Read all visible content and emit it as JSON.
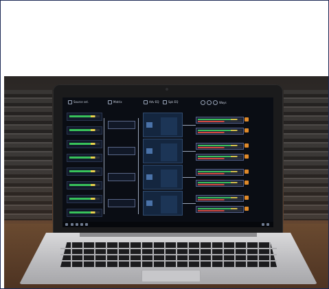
{
  "ui": {
    "sections": {
      "source": "Source sel.",
      "matrix": "Matrix",
      "adv": "Adv EQ",
      "spk": "Spk EQ",
      "ways": "Ways"
    }
  },
  "colors": {
    "meter_green": "#38c35a",
    "meter_yellow": "#e7d24c",
    "meter_red": "#d2473f",
    "mute_orange": "#e08a2a",
    "panel_blue": "#14263f"
  }
}
